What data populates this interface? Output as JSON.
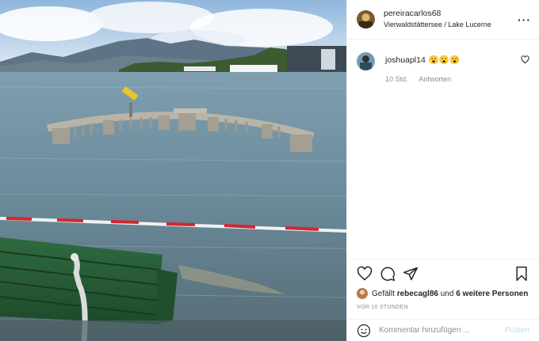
{
  "post": {
    "username": "pereiracarlos68",
    "location": "Vierwaldstättersee / Lake Lucerne"
  },
  "comments": [
    {
      "username": "joshuapl14",
      "text": "😮😮😮",
      "time": "10 Std.",
      "reply_label": "Antworten"
    }
  ],
  "likes": {
    "prefix": "Gefällt",
    "user": "rebecagl86",
    "connector": "und",
    "others": "6 weitere Personen"
  },
  "timestamp": "VOR 10 STUNDEN",
  "comment_box": {
    "placeholder": "Kommentar hinzufügen ...",
    "post_label": "Posten"
  },
  "icons": {
    "more": "more-options-icon",
    "like": "heart-icon",
    "comment": "comment-icon",
    "share": "share-icon",
    "save": "bookmark-icon",
    "emoji": "emoji-icon"
  }
}
